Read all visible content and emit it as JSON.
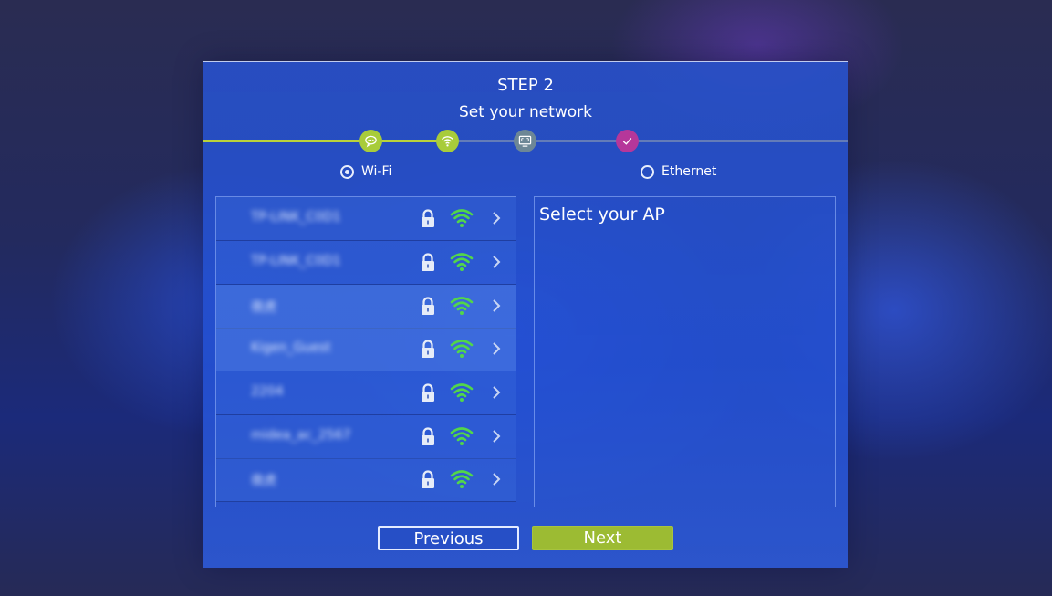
{
  "wizard": {
    "step_title": "STEP 2",
    "step_subtitle": "Set your network",
    "progress_nodes": [
      {
        "icon": "chat-bubble-icon",
        "state": "done",
        "color": "#a8cc3a"
      },
      {
        "icon": "wifi-icon",
        "state": "current",
        "color": "#a8cc3a"
      },
      {
        "icon": "screen-icon",
        "state": "pending",
        "color": "#6d8796"
      },
      {
        "icon": "checkmark-icon",
        "state": "pending",
        "color": "#b6379a"
      }
    ],
    "progress_color": "#b9d23a"
  },
  "network_type": {
    "wifi_label": "Wi-Fi",
    "ethernet_label": "Ethernet",
    "selected": "wifi"
  },
  "ap_list": [
    {
      "name": "TP-LINK_C0D1",
      "secured": true,
      "signal_icon": "wifi-icon"
    },
    {
      "name": "TP-LINK_C0D1",
      "secured": true,
      "signal_icon": "wifi-icon"
    },
    {
      "name": "夜虎",
      "secured": true,
      "signal_icon": "wifi-icon"
    },
    {
      "name": "Kigen_Guest",
      "secured": true,
      "signal_icon": "wifi-icon"
    },
    {
      "name": "2204",
      "secured": true,
      "signal_icon": "wifi-icon"
    },
    {
      "name": "midea_ac_2567",
      "secured": true,
      "signal_icon": "wifi-icon"
    },
    {
      "name": "夜虎",
      "secured": true,
      "signal_icon": "wifi-icon"
    }
  ],
  "detail": {
    "title": "Select your AP"
  },
  "buttons": {
    "previous": "Previous",
    "next": "Next",
    "next_color": "#9cbb33"
  },
  "colors": {
    "wifi_green": "#52d64a",
    "panel_blue": "#2850c8"
  }
}
